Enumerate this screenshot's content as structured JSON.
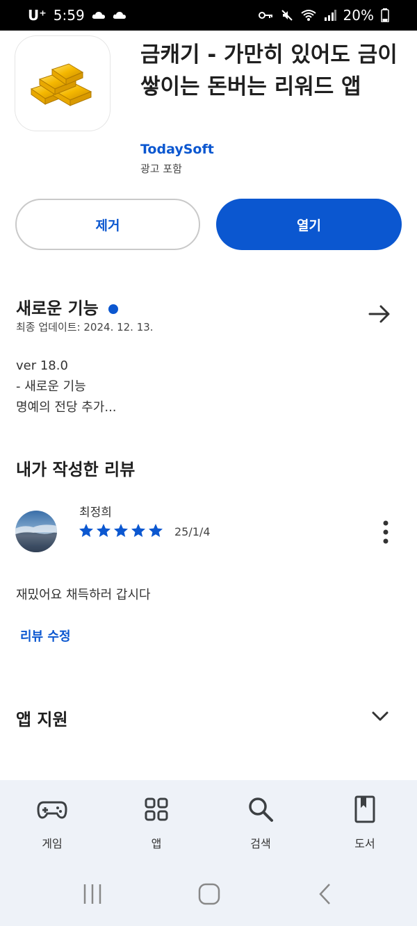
{
  "status_bar": {
    "carrier": "U⁺",
    "time": "5:59",
    "battery": "20%"
  },
  "app": {
    "title": "금캐기 - 가만히 있어도 금이 쌓이는 돈버는 리워드 앱",
    "developer": "TodaySoft",
    "ads_label": "광고 포함",
    "icon": "gold-bars-icon"
  },
  "actions": {
    "uninstall_label": "제거",
    "open_label": "열기"
  },
  "whats_new": {
    "title": "새로운 기능",
    "updated": "최종 업데이트: 2024. 12. 13.",
    "notes": [
      "ver 18.0",
      "- 새로운 기능",
      "명예의 전당 추가..."
    ]
  },
  "my_review": {
    "title": "내가 작성한 리뷰",
    "reviewer": "최정희",
    "rating": 5,
    "date": "25/1/4",
    "text": "재밌어요 채득하러 갑시다",
    "edit_label": "리뷰 수정"
  },
  "app_support": {
    "title": "앱 지원"
  },
  "bottom_nav": {
    "items": [
      {
        "label": "게임",
        "icon": "gamepad-icon"
      },
      {
        "label": "앱",
        "icon": "apps-grid-icon"
      },
      {
        "label": "검색",
        "icon": "search-icon"
      },
      {
        "label": "도서",
        "icon": "book-icon"
      }
    ]
  },
  "colors": {
    "accent": "#0b57d0",
    "nav_bg": "#eef2f8"
  }
}
